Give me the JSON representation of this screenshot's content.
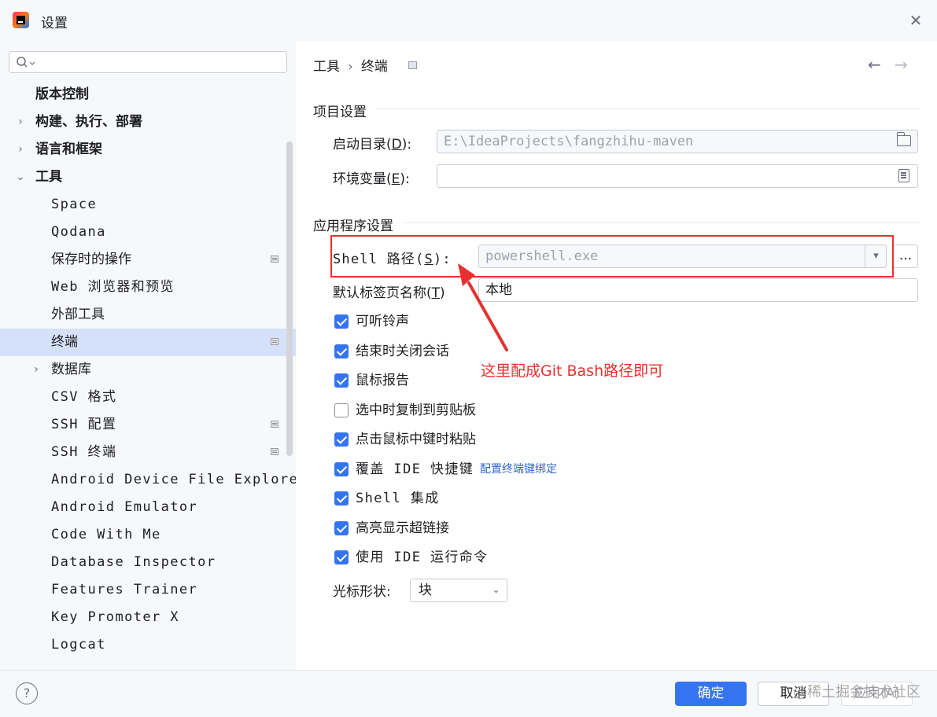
{
  "window": {
    "title": "设置"
  },
  "search": {
    "placeholder": ""
  },
  "sidebar": {
    "items": [
      {
        "label": "版本控制",
        "level": 0,
        "expandable": false
      },
      {
        "label": "构建、执行、部署",
        "level": 0,
        "expandable": true,
        "expanded": false
      },
      {
        "label": "语言和框架",
        "level": 0,
        "expandable": true,
        "expanded": false
      },
      {
        "label": "工具",
        "level": 0,
        "expandable": true,
        "expanded": true
      },
      {
        "label": "Space",
        "level": 1
      },
      {
        "label": "Qodana",
        "level": 1
      },
      {
        "label": "保存时的操作",
        "level": 1,
        "page_icon": true
      },
      {
        "label": "Web 浏览器和预览",
        "level": 1
      },
      {
        "label": "外部工具",
        "level": 1
      },
      {
        "label": "终端",
        "level": 1,
        "page_icon": true,
        "selected": true
      },
      {
        "label": "数据库",
        "level": 1,
        "expandable": true,
        "expanded": false
      },
      {
        "label": "CSV 格式",
        "level": 1
      },
      {
        "label": "SSH 配置",
        "level": 1,
        "page_icon": true
      },
      {
        "label": "SSH 终端",
        "level": 1,
        "page_icon": true
      },
      {
        "label": "Android Device File Explore",
        "level": 1
      },
      {
        "label": "Android Emulator",
        "level": 1
      },
      {
        "label": "Code With Me",
        "level": 1
      },
      {
        "label": "Database Inspector",
        "level": 1
      },
      {
        "label": "Features Trainer",
        "level": 1
      },
      {
        "label": "Key Promoter X",
        "level": 1
      },
      {
        "label": "Logcat",
        "level": 1
      }
    ]
  },
  "breadcrumb": {
    "parent": "工具",
    "separator": "›",
    "current": "终端"
  },
  "project_settings": {
    "title": "项目设置",
    "start_dir": {
      "label_pre": "启动目录(",
      "mnemonic": "D",
      "label_post": "):",
      "value": "E:\\IdeaProjects\\fangzhihu-maven"
    },
    "env_vars": {
      "label_pre": "环境变量(",
      "mnemonic": "E",
      "label_post": "):",
      "value": ""
    }
  },
  "app_settings": {
    "title": "应用程序设置",
    "shell_path": {
      "label_pre": "Shell 路径(",
      "mnemonic": "S",
      "label_post": "):",
      "value": "powershell.exe",
      "browse": "..."
    },
    "tab_name": {
      "label_pre": "默认标签页名称(",
      "mnemonic": "T",
      "label_post": ")",
      "value": "本地"
    },
    "checkboxes": [
      {
        "label": "可听铃声",
        "checked": true
      },
      {
        "label": "结束时关闭会话",
        "checked": true
      },
      {
        "label": "鼠标报告",
        "checked": true
      },
      {
        "label": "选中时复制到剪贴板",
        "checked": false
      },
      {
        "label": "点击鼠标中键时粘贴",
        "checked": true
      },
      {
        "label": "覆盖 IDE 快捷键",
        "checked": true,
        "link": "配置终端键绑定"
      },
      {
        "label": "Shell 集成",
        "checked": true
      },
      {
        "label": "高亮显示超链接",
        "checked": true
      },
      {
        "label": "使用 IDE 运行命令",
        "checked": true
      }
    ],
    "cursor_shape": {
      "label": "光标形状:",
      "value": "块"
    }
  },
  "annotation": {
    "text": "这里配成Git Bash路径即可",
    "color": "#e5312f"
  },
  "footer": {
    "help": "?",
    "ok": "确定",
    "cancel": "取消",
    "apply": "应用(A)"
  },
  "watermark": "@稀土掘金技术社区",
  "colors": {
    "accent": "#3574f0",
    "selected_row": "#d5e1f9",
    "link": "#2f65ca"
  }
}
